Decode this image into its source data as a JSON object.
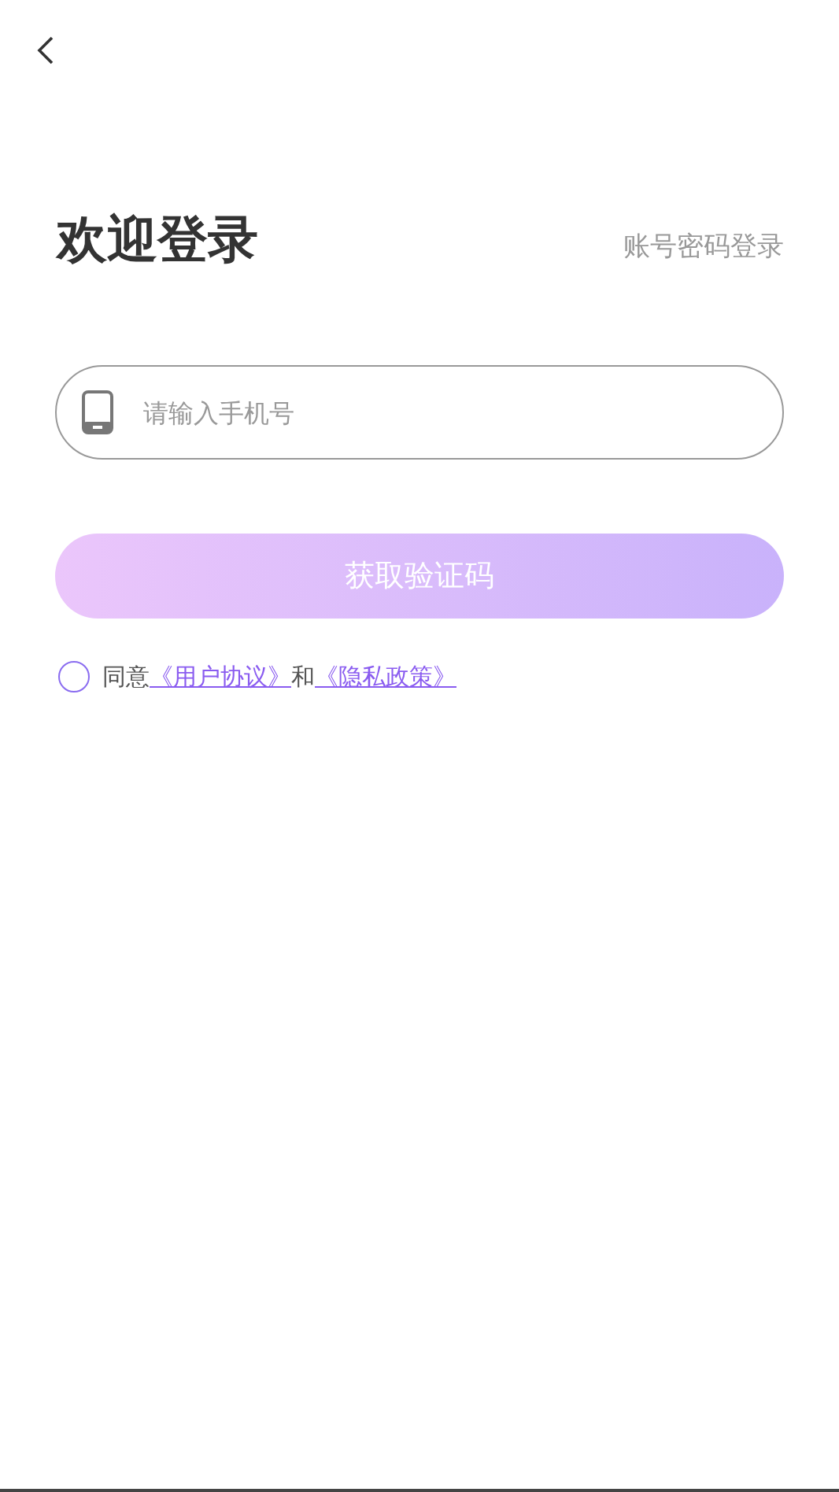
{
  "title": "欢迎登录",
  "alt_login_link": "账号密码登录",
  "phone_field": {
    "placeholder": "请输入手机号"
  },
  "submit_button": {
    "label": "获取验证码",
    "disabled": true
  },
  "agreement": {
    "checked": false,
    "prefix": "同意",
    "link_1": "《用户协议》",
    "joiner": "和",
    "link_2": "《隐私政策》"
  }
}
